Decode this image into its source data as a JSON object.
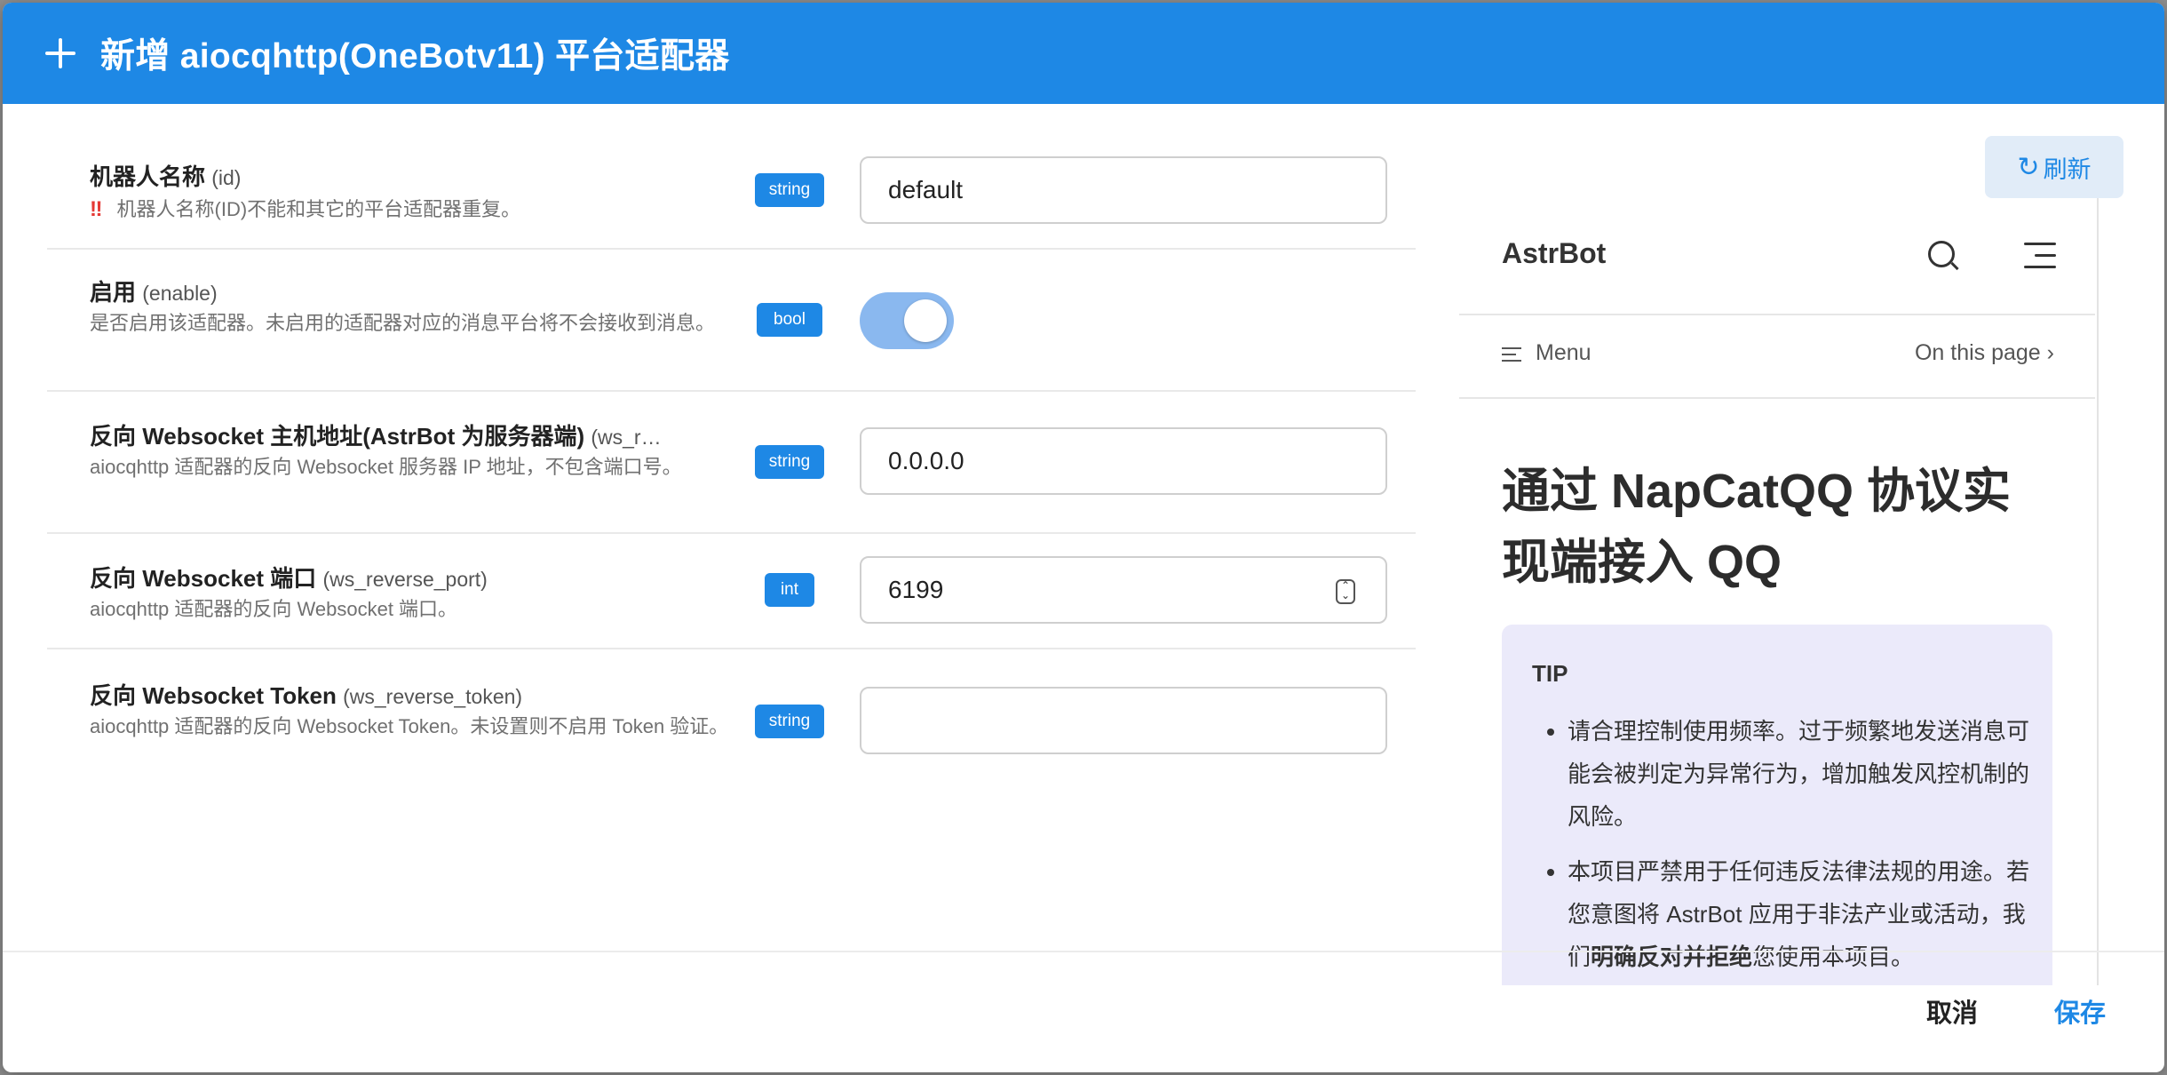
{
  "dialog": {
    "title": "新增 aiocqhttp(OneBotv11) 平台适配器"
  },
  "form": {
    "rows": [
      {
        "label": "机器人名称",
        "key": "(id)",
        "warn": "‼",
        "desc": "机器人名称(ID)不能和其它的平台适配器重复。",
        "type": "string",
        "value": "default"
      },
      {
        "label": "启用",
        "key": "(enable)",
        "desc": "是否启用该适配器。未启用的适配器对应的消息平台将不会接收到消息。",
        "type": "bool",
        "value": true
      },
      {
        "label": "反向 Websocket 主机地址(AstrBot 为服务器端)",
        "key": "(ws_r…",
        "desc": "aiocqhttp 适配器的反向 Websocket 服务器 IP 地址，不包含端口号。",
        "type": "string",
        "value": "0.0.0.0"
      },
      {
        "label": "反向 Websocket 端口",
        "key": "(ws_reverse_port)",
        "desc": "aiocqhttp 适配器的反向 Websocket 端口。",
        "type": "int",
        "value": "6199"
      },
      {
        "label": "反向 Websocket Token",
        "key": "(ws_reverse_token)",
        "desc": "aiocqhttp 适配器的反向 Websocket Token。未设置则不启用 Token 验证。",
        "type": "string",
        "value": ""
      }
    ]
  },
  "docs": {
    "refresh_label": "刷新",
    "brand": "AstrBot",
    "menu_label": "Menu",
    "on_this_page": "On this page",
    "heading": "通过 NapCatQQ 协议实现端接入 QQ",
    "tip_title": "TIP",
    "tip_item_1": "请合理控制使用频率。过于频繁地发送消息可能会被判定为异常行为，增加触发风控机制的风险。",
    "tip_item_2_pre": "本项目严禁用于任何违反法律法规的用途。若您意图将 AstrBot 应用于非法产业或活动，我们",
    "tip_item_2_bold": "明确反对并拒绝",
    "tip_item_2_post": "您使用本项目。"
  },
  "actions": {
    "cancel_label": "取消",
    "save_label": "保存"
  },
  "colors": {
    "primary": "#1e88e5",
    "toggle_on": "#8ab8ef",
    "tip_background": "#ebeafa",
    "warn": "#e53935"
  }
}
